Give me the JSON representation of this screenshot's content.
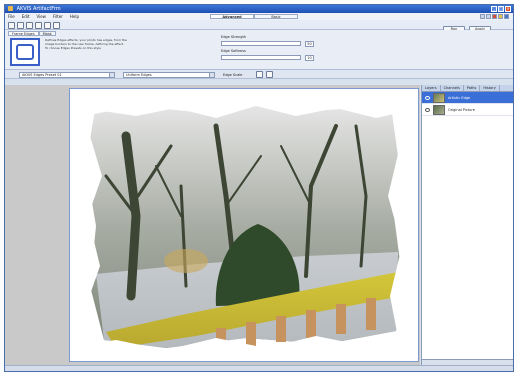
{
  "window": {
    "title": "AKVIS ArtifactFrm"
  },
  "menu": [
    "File",
    "Edit",
    "View",
    "Filter",
    "Help"
  ],
  "mode_tabs": [
    {
      "label": "Advanced",
      "active": true
    },
    {
      "label": "Basic",
      "active": false
    }
  ],
  "actions": {
    "run": "Run",
    "apply": "Apply"
  },
  "options": {
    "tabs": [
      {
        "label": "Frame Edges",
        "active": true
      },
      {
        "label": "Mask",
        "active": false
      }
    ],
    "hint": "Defines Edges effects: your photo has edges, from the image borders to the new frame, defining the effect. To choose Edges Presets on this style",
    "edge_strength": {
      "label": "Edge Strength",
      "value": "50"
    },
    "edge_softness": {
      "label": "Edge Softness",
      "value": "10"
    }
  },
  "presetbar": {
    "preset": "AKVIS Edges Preset 01",
    "mode": "Uniform Edges",
    "zoom_label": "Edge Scale"
  },
  "layers": {
    "tabs": [
      "Layers",
      "Channels",
      "Paths",
      "History"
    ],
    "items": [
      {
        "name": "Artistic Edge",
        "selected": true
      },
      {
        "name": "Original Picture",
        "selected": false
      }
    ]
  },
  "colors": {
    "accent": "#3a6fd8",
    "frame": "#d4c63a",
    "trees": "#3d4534"
  }
}
